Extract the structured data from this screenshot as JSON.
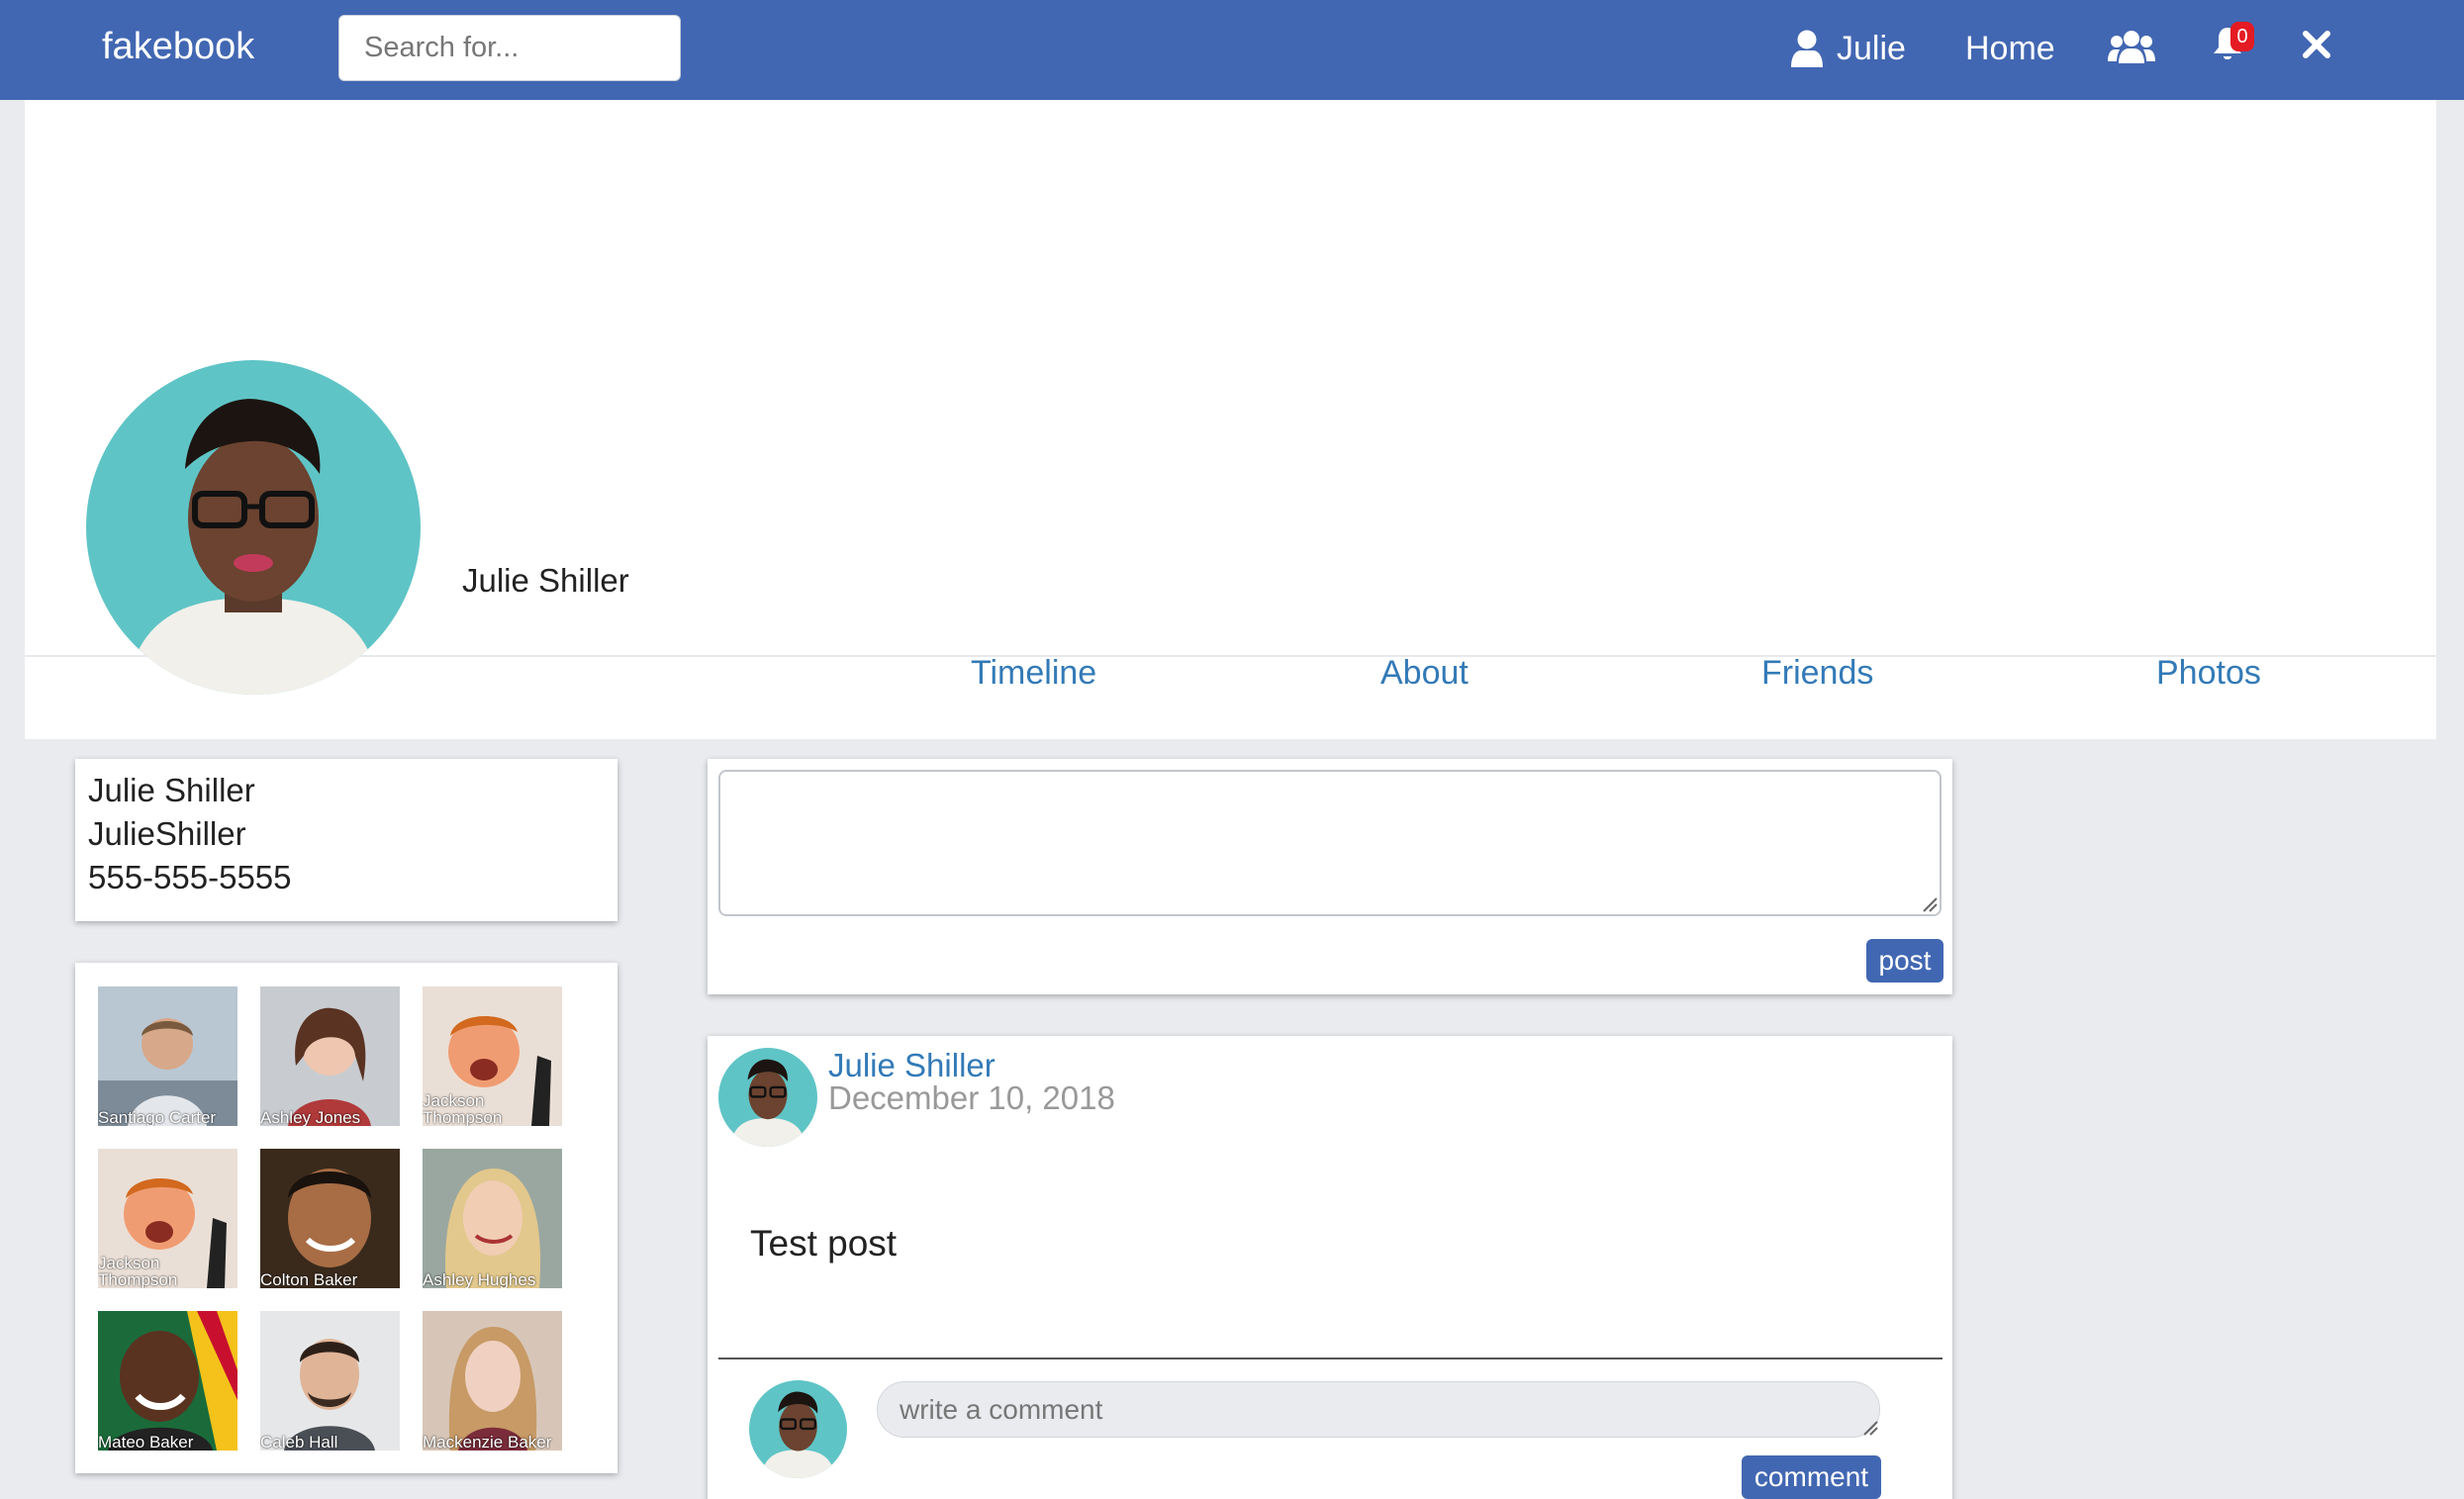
{
  "navbar": {
    "brand": "fakebook",
    "search_placeholder": "Search for...",
    "user_name": "Julie",
    "home": "Home",
    "notification_count": "0",
    "colors": {
      "bar": "#4267b2",
      "badge": "#e41b23"
    }
  },
  "profile": {
    "name": "Julie Shiller",
    "tabs": [
      {
        "label": "Timeline"
      },
      {
        "label": "About"
      },
      {
        "label": "Friends"
      },
      {
        "label": "Photos"
      }
    ]
  },
  "about_card": {
    "full_name": "Julie Shiller",
    "username": "JulieShiller",
    "phone": "555-555-5555"
  },
  "friends": [
    {
      "name": "Santiago Carter"
    },
    {
      "name": "Ashley Jones"
    },
    {
      "name": "Jackson Thompson"
    },
    {
      "name": "Jackson Thompson"
    },
    {
      "name": "Colton Baker"
    },
    {
      "name": "Ashley Hughes"
    },
    {
      "name": "Mateo Baker"
    },
    {
      "name": "Caleb Hall"
    },
    {
      "name": "Mackenzie Baker"
    }
  ],
  "composer": {
    "post_label": "post"
  },
  "post": {
    "author": "Julie Shiller",
    "date": "December 10, 2018",
    "body": "Test post",
    "comment_placeholder": "write a comment",
    "comment_label": "comment"
  }
}
